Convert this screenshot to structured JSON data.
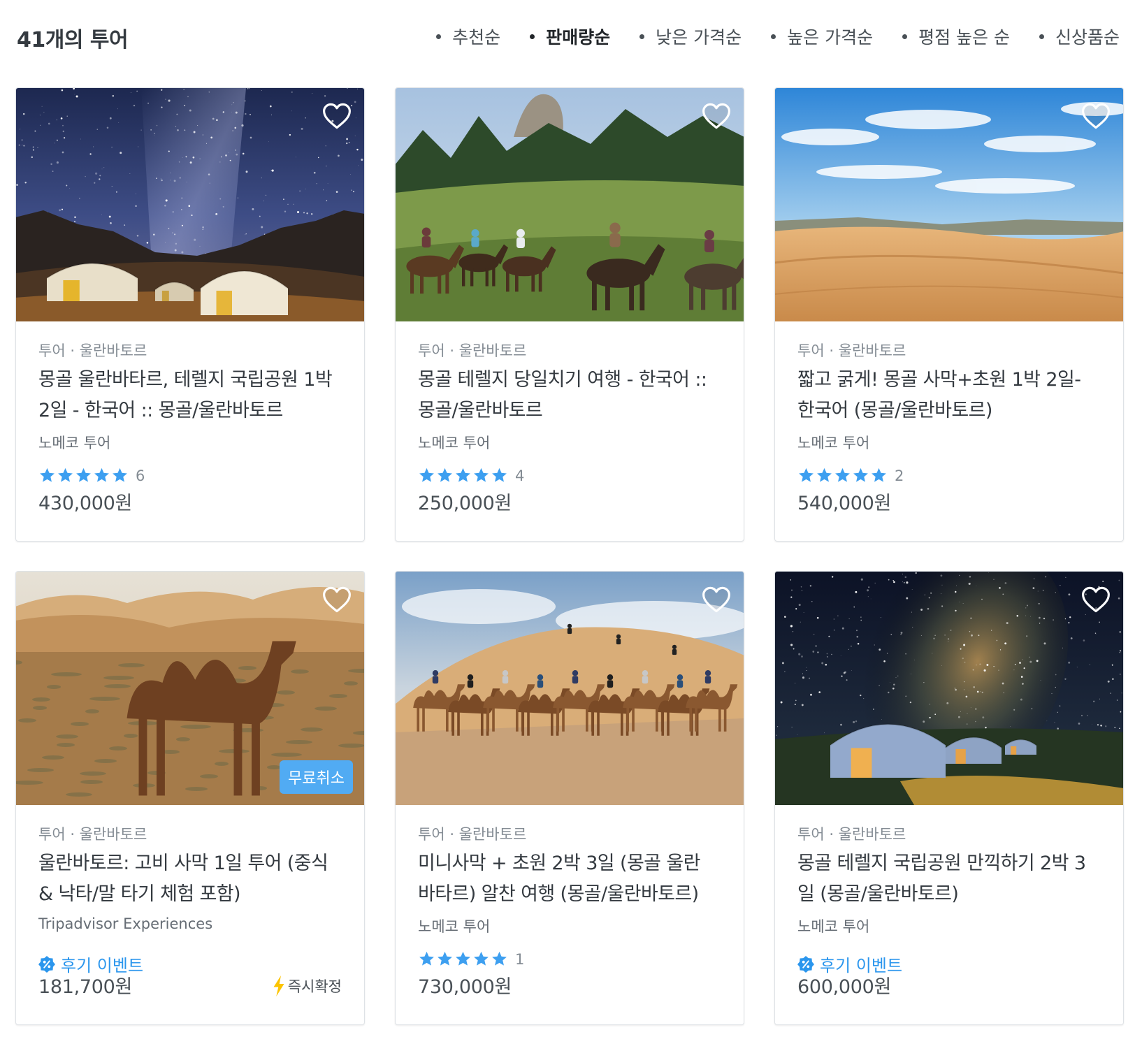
{
  "header": {
    "result_count": "41개의 투어",
    "sort_options": [
      {
        "label": "추천순",
        "active": false
      },
      {
        "label": "판매량순",
        "active": true
      },
      {
        "label": "낮은 가격순",
        "active": false
      },
      {
        "label": "높은 가격순",
        "active": false
      },
      {
        "label": "평점 높은 순",
        "active": false
      },
      {
        "label": "신상품순",
        "active": false
      }
    ]
  },
  "colors": {
    "star": "#3d9ff0",
    "accent_blue": "#2b96ed",
    "badge": "#51abf3",
    "bolt": "#fcc400"
  },
  "cards": [
    {
      "category": "투어 · 울란바토르",
      "title": "몽골 울란바타르, 테렐지 국립공원 1박 2일 - 한국어 :: 몽골/울란바토르",
      "provider": "노메코 투어",
      "rating_stars": 5,
      "review_count": "6",
      "event_label": "",
      "price": "430,000원",
      "instant_label": "",
      "free_cancel_label": "",
      "icons": {
        "wishlist": "heart-outline-icon",
        "rating": "star-icon"
      }
    },
    {
      "category": "투어 · 울란바토르",
      "title": "몽골 테렐지 당일치기 여행 - 한국어 :: 몽골/울란바토르",
      "provider": "노메코 투어",
      "rating_stars": 5,
      "review_count": "4",
      "event_label": "",
      "price": "250,000원",
      "instant_label": "",
      "free_cancel_label": "",
      "icons": {
        "wishlist": "heart-outline-icon",
        "rating": "star-icon"
      }
    },
    {
      "category": "투어 · 울란바토르",
      "title": "짧고 굵게! 몽골 사막+초원 1박 2일- 한국어 (몽골/울란바토르)",
      "provider": "노메코 투어",
      "rating_stars": 5,
      "review_count": "2",
      "event_label": "",
      "price": "540,000원",
      "instant_label": "",
      "free_cancel_label": "",
      "icons": {
        "wishlist": "heart-outline-icon",
        "rating": "star-icon"
      }
    },
    {
      "category": "투어 · 울란바토르",
      "title": "울란바토르: 고비 사막 1일 투어 (중식 & 낙타/말 타기 체험 포함)",
      "provider": "Tripadvisor Experiences",
      "rating_stars": 0,
      "review_count": "",
      "event_label": "후기 이벤트",
      "price": "181,700원",
      "instant_label": "즉시확정",
      "free_cancel_label": "무료취소",
      "icons": {
        "wishlist": "heart-outline-icon",
        "event": "discount-badge-icon",
        "instant": "lightning-bolt-icon"
      }
    },
    {
      "category": "투어 · 울란바토르",
      "title": "미니사막 + 초원 2박 3일 (몽골 울란 바타르) 알찬 여행 (몽골/울란바토르)",
      "provider": "노메코 투어",
      "rating_stars": 5,
      "review_count": "1",
      "event_label": "",
      "price": "730,000원",
      "instant_label": "",
      "free_cancel_label": "",
      "icons": {
        "wishlist": "heart-outline-icon",
        "rating": "star-icon"
      }
    },
    {
      "category": "투어 · 울란바토르",
      "title": "몽골 테렐지 국립공원 만끽하기 2박 3 일 (몽골/울란바토르)",
      "provider": "노메코 투어",
      "rating_stars": 0,
      "review_count": "",
      "event_label": "후기 이벤트",
      "price": "600,000원",
      "instant_label": "",
      "free_cancel_label": "",
      "icons": {
        "wishlist": "heart-outline-icon",
        "event": "discount-badge-icon"
      }
    }
  ]
}
